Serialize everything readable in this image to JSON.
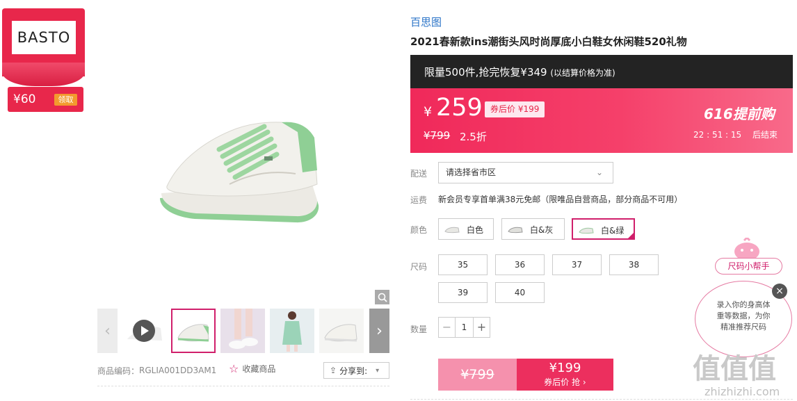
{
  "brand_card": {
    "logo": "BASTO",
    "coupon_value": "¥60",
    "claim_label": "领取"
  },
  "thumbnails": {
    "prev_arrow": "‹",
    "next_arrow": "›",
    "items": [
      "video",
      "white-green-shoe",
      "model-leg",
      "model-full",
      "white-shoe"
    ]
  },
  "product_meta": {
    "code_label": "商品编码：",
    "code_value": "RGLIA001DD3AM1",
    "favorite_label": "收藏商品",
    "share_label": "分享到:"
  },
  "product": {
    "brand": "百思图",
    "title": "2021春新款ins潮街头风时尚厚底小白鞋女休闲鞋520礼物"
  },
  "promo": {
    "limit_text": "限量500件,抢完恢复¥349",
    "limit_note": "(以结算价格为准)",
    "currency": "¥",
    "price": "259",
    "coupon_price": "券后价 ¥199",
    "original_price": "¥799",
    "discount": "2.5折",
    "event_name": "616提前购",
    "countdown": "22 : 51 : 15",
    "countdown_suffix": "后结束"
  },
  "delivery": {
    "label": "配送",
    "placeholder": "请选择省市区"
  },
  "shipping": {
    "label": "运费",
    "text": "新会员专享首单满38元免邮（限唯品自营商品，部分商品不可用）"
  },
  "colors": {
    "label": "颜色",
    "options": [
      "白色",
      "白&灰",
      "白&绿"
    ],
    "selected": "白&绿"
  },
  "sizes": {
    "label": "尺码",
    "options": [
      "35",
      "36",
      "37",
      "38",
      "39",
      "40"
    ]
  },
  "quantity": {
    "label": "数量",
    "minus": "−",
    "value": "1",
    "plus": "+"
  },
  "buy": {
    "original_price": "¥799",
    "coupon_price": "¥199",
    "coupon_action": "券后价 抢 ›"
  },
  "helper": {
    "button_label": "尺码小帮手",
    "bubble_line1": "录入你的身高体",
    "bubble_line2": "重等数据，为你",
    "bubble_line3": "精准推荐尺码",
    "close": "×"
  },
  "watermark": {
    "logo_text": "值值值",
    "url": "zhizhizhi.com"
  },
  "colors_theme": {
    "accent": "#d01f6b",
    "price_red": "#ec2f5e",
    "brand_blue": "#2a73c7",
    "dark_bar": "#232323"
  }
}
